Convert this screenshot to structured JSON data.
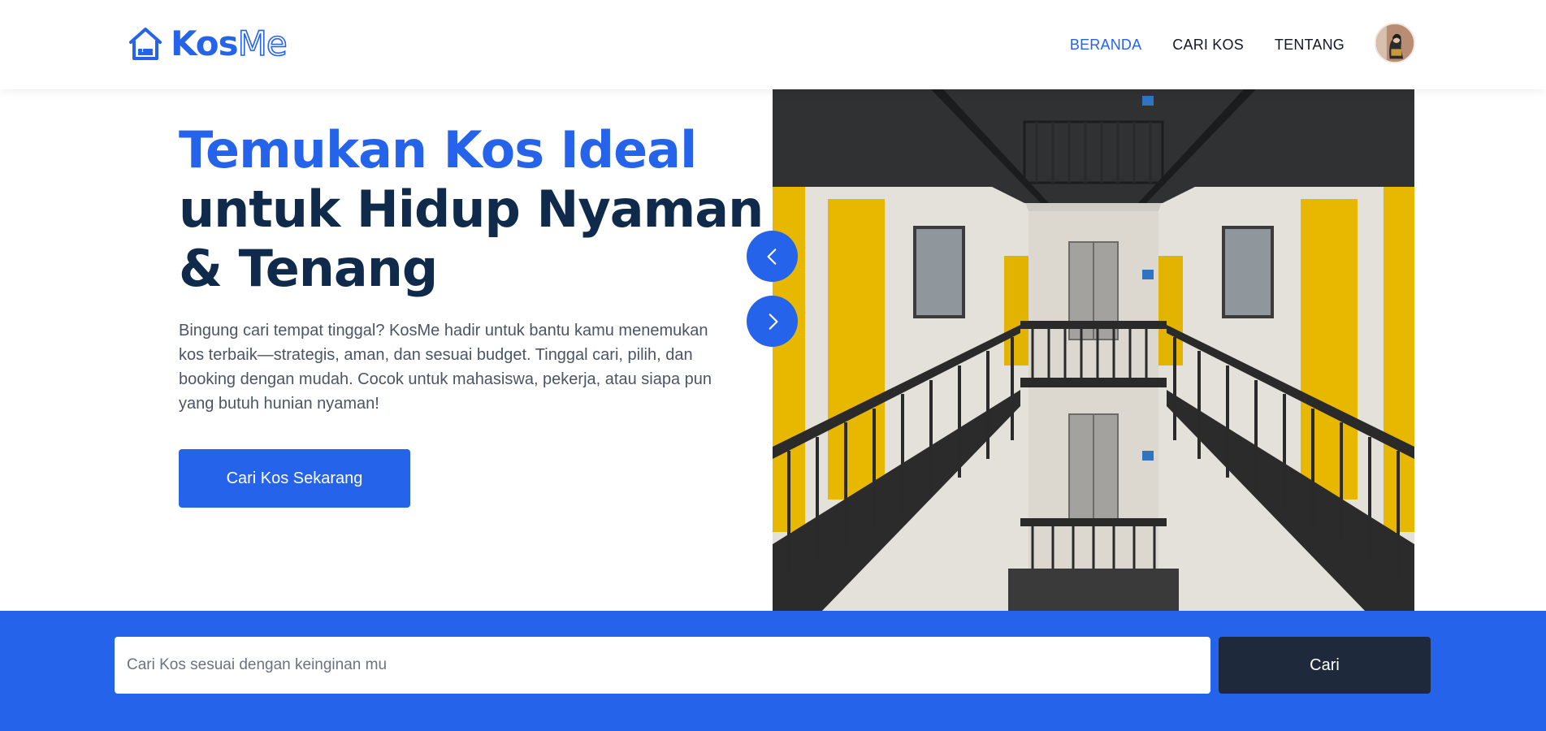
{
  "brand": {
    "name_part1": "Kos",
    "name_part2": "Me",
    "logo_icon": "house-bed-icon"
  },
  "nav": {
    "items": [
      {
        "label": "BERANDA",
        "active": true
      },
      {
        "label": "CARI KOS",
        "active": false
      },
      {
        "label": "TENTANG",
        "active": false
      }
    ],
    "avatar_icon": "user-avatar"
  },
  "hero": {
    "title_highlight": "Temukan Kos Ideal",
    "title_line2": "untuk Hidup Nyaman",
    "title_line3": "& Tenang",
    "description": "Bingung cari tempat tinggal? KosMe hadir untuk bantu kamu menemukan kos terbaik—strategis, aman, dan sesuai budget. Tinggal cari, pilih, dan booking dengan mudah. Cocok untuk mahasiswa, pekerja, atau siapa pun yang butuh hunian nyaman!",
    "cta_label": "Cari Kos Sekarang"
  },
  "carousel": {
    "prev_icon": "chevron-left-icon",
    "next_icon": "chevron-right-icon"
  },
  "search": {
    "placeholder": "Cari Kos sesuai dengan keinginan mu",
    "value": "",
    "button_label": "Cari"
  },
  "colors": {
    "primary": "#2563eb",
    "heading": "#0f2a4a",
    "dark_button": "#1e293b",
    "door_yellow": "#e8b800"
  }
}
